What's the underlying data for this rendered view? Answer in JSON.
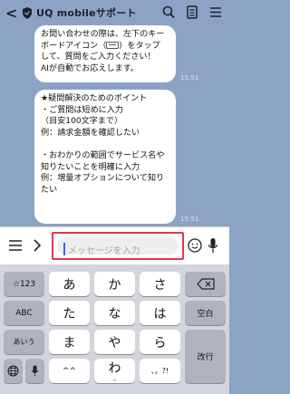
{
  "header": {
    "back_glyph": "<",
    "title": "UQ mobileサポート",
    "icons": [
      "shield-icon",
      "search-icon",
      "notebook-icon",
      "menu-icon"
    ]
  },
  "messages": [
    {
      "text_before_icon": "お問い合わせの際は、左下のキー\nボードアイコン（",
      "text_after_icon": "）をタップ\nして、質問をご入力ください！\nAIが自動でお応えします。",
      "time": "15:51"
    },
    {
      "text": "★疑問解決のためのポイント\n・ご質問は短めに入力\n（目安100文字まで）\n例：請求金額を確認したい\n\n・おわかりの範囲でサービス名や\n知りたいことを明確に入力\n例：増量オプションについて知り\nたい",
      "time": "15:51"
    }
  ],
  "input": {
    "placeholder": "メッセージを入力"
  },
  "keyboard": {
    "rows": [
      [
        "☆123",
        "あ",
        "か",
        "さ",
        "⌫"
      ],
      [
        "ABC",
        "た",
        "な",
        "は",
        "空白"
      ],
      [
        "あいう",
        "ま",
        "や",
        "ら",
        "改行"
      ],
      [
        "🌐",
        "🎤",
        "^^",
        "わ",
        "、。?!"
      ]
    ],
    "dakuten_label": "ﾞﾟ小",
    "wa_sub": "_",
    "wa_label": "わ"
  }
}
